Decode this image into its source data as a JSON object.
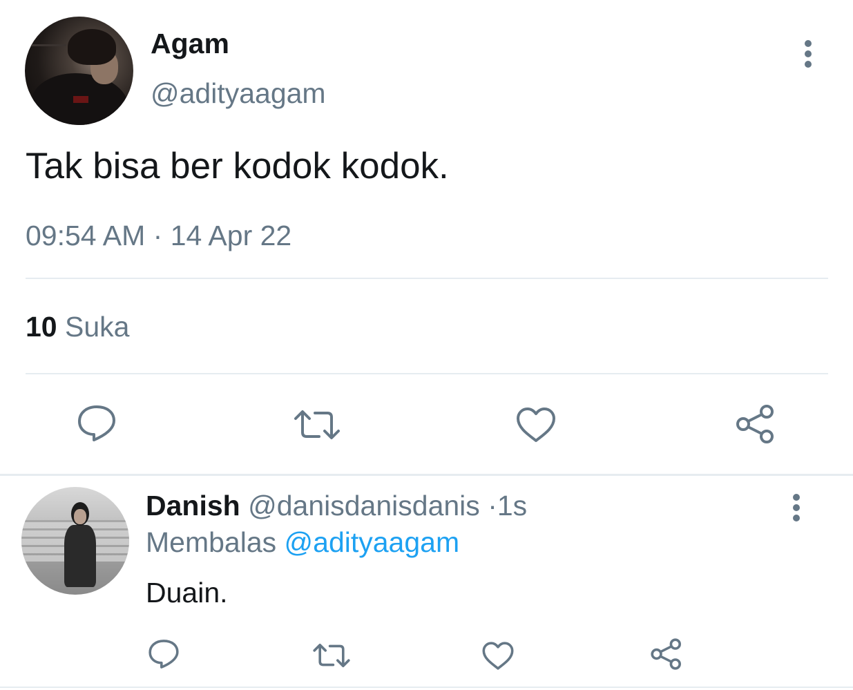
{
  "main_tweet": {
    "author_name": "Agam",
    "author_handle": "@adityaagam",
    "text": "Tak bisa ber kodok kodok.",
    "time": "09:54 AM",
    "separator": "·",
    "date": "14 Apr 22",
    "likes_count": "10",
    "likes_label": "Suka",
    "more_icon": "more-vertical-icon",
    "actions": [
      "reply-icon",
      "retweet-icon",
      "like-icon",
      "share-icon"
    ]
  },
  "reply_tweet": {
    "author_name": "Danish",
    "author_handle": "@danisdanisdanis",
    "separator": "·",
    "time_ago": "1s",
    "replying_label": "Membalas",
    "replying_to": "@adityaagam",
    "text": "Duain.",
    "more_icon": "more-vertical-icon",
    "actions": [
      "reply-icon",
      "retweet-icon",
      "like-icon",
      "share-icon"
    ]
  },
  "colors": {
    "text_primary": "#14171a",
    "text_secondary": "#657786",
    "link": "#1da1f2",
    "divider": "#e6ecf0",
    "background": "#ffffff"
  }
}
